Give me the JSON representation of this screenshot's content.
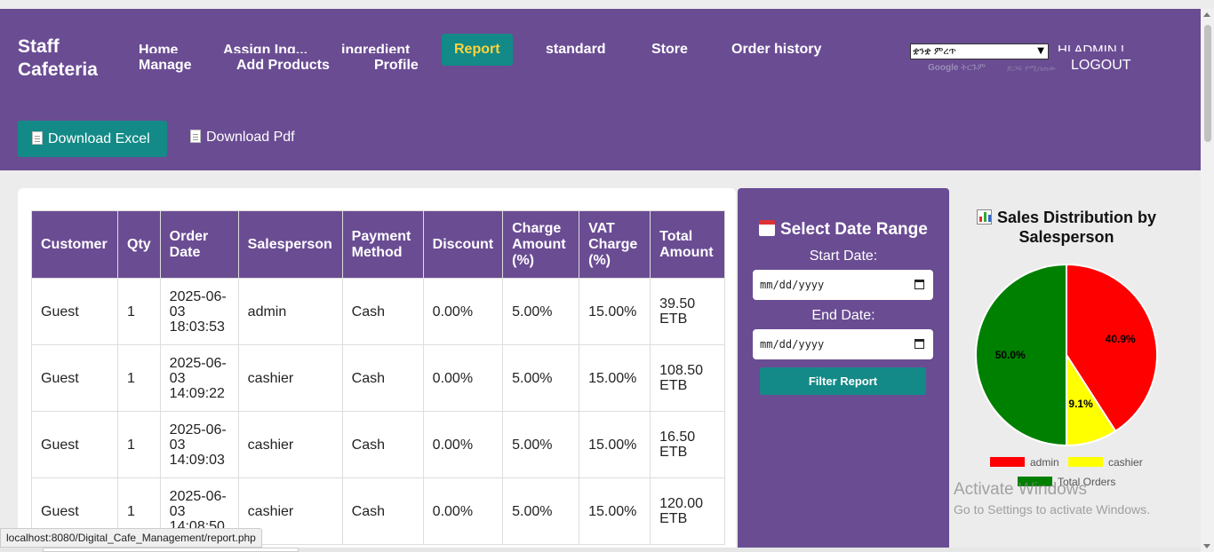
{
  "brand": {
    "line1": "Staff",
    "line2": "Cafeteria"
  },
  "nav": {
    "home": "Home",
    "assign": "Assign Ing...",
    "ingredient": "ingredient",
    "report": "Report",
    "standard": "standard",
    "store": "Store",
    "order_history": "Order history",
    "manage": "Manage",
    "add_products": "Add Products",
    "profile": "Profile"
  },
  "language": {
    "selected": "ቋንቋ ምረጥ",
    "powered_by": "Google",
    "translate": "ትርጉም",
    "dim_text": "ድጋፍ የሚሰጠው"
  },
  "user": {
    "greeting": "HI ADMIN !",
    "logout": "LOGOUT"
  },
  "actions": {
    "excel": "Download Excel",
    "pdf": "Download Pdf"
  },
  "table": {
    "headers": [
      "Customer",
      "Qty",
      "Order Date",
      "Salesperson",
      "Payment Method",
      "Discount",
      "Charge Amount (%)",
      "VAT Charge (%)",
      "Total Amount"
    ],
    "rows": [
      [
        "Guest",
        "1",
        "2025-06-03 18:03:53",
        "admin",
        "Cash",
        "0.00%",
        "5.00%",
        "15.00%",
        "39.50 ETB"
      ],
      [
        "Guest",
        "1",
        "2025-06-03 14:09:22",
        "cashier",
        "Cash",
        "0.00%",
        "5.00%",
        "15.00%",
        "108.50 ETB"
      ],
      [
        "Guest",
        "1",
        "2025-06-03 14:09:03",
        "cashier",
        "Cash",
        "0.00%",
        "5.00%",
        "15.00%",
        "16.50 ETB"
      ],
      [
        "Guest",
        "1",
        "2025-06-03 14:08:50",
        "cashier",
        "Cash",
        "0.00%",
        "5.00%",
        "15.00%",
        "120.00 ETB"
      ]
    ]
  },
  "filter": {
    "title": "Select Date Range",
    "start_label": "Start Date:",
    "end_label": "End Date:",
    "date_placeholder": "mm/dd/yyyy",
    "button": "Filter Report"
  },
  "chart_data": {
    "type": "pie",
    "title": "Sales Distribution by Salesperson",
    "slices": [
      {
        "label": "admin",
        "value": 40.9,
        "display": "40.9%",
        "color": "#ff0000"
      },
      {
        "label": "cashier",
        "value": 9.1,
        "display": "9.1%",
        "color": "#ffff00"
      },
      {
        "label": "Total Orders",
        "value": 50.0,
        "display": "50.0%",
        "color": "#008000"
      }
    ]
  },
  "watermark": {
    "line1": "Activate Windows",
    "line2": "Go to Settings to activate Windows."
  },
  "status_url": "localhost:8080/Digital_Cafe_Management/report.php"
}
